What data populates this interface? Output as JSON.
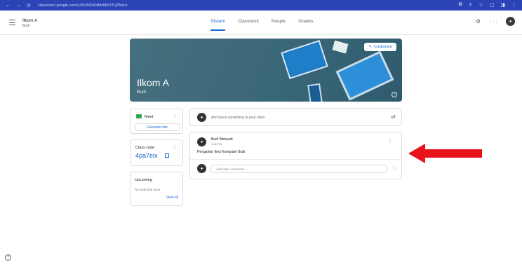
{
  "browser": {
    "nav_icons": [
      "←",
      "→",
      "⟳"
    ],
    "url": "classroom.google.com/u/0/c/NDM4MzM0OTQ0Nzcz",
    "right_icons": [
      "⧉",
      "⇪",
      "☆",
      "▢",
      "◨",
      "⋮"
    ]
  },
  "header": {
    "class_name": "Ilkom A",
    "class_section": "Budi",
    "tabs": [
      "Stream",
      "Classwork",
      "People",
      "Grades"
    ],
    "active_tab": "Stream",
    "settings_glyph": "⚙",
    "apps_glyph": "⋮⋮⋮",
    "avatar_glyph": "●"
  },
  "banner": {
    "title": "Ilkom A",
    "subtitle": "Budi",
    "customize_label": "Customize",
    "customize_glyph": "✎",
    "info_glyph": "i"
  },
  "meet": {
    "label": "Meet",
    "generate_link": "Generate link",
    "menu_glyph": "⋮"
  },
  "class_code": {
    "label": "Class code",
    "value": "4pa7eix",
    "menu_glyph": "⋮"
  },
  "upcoming": {
    "title": "Upcoming",
    "empty_text": "No work due soon",
    "view_all": "View all"
  },
  "announce": {
    "placeholder": "Announce something to your class",
    "repost_glyph": "⇄"
  },
  "post": {
    "author": "Budi Wahyudi",
    "time": "3:16 PM",
    "body": "Pengantar Ilmu Komputer Budi",
    "comment_placeholder": "Add class comment...",
    "send_glyph": "▷",
    "menu_glyph": "⋮"
  },
  "help_glyph": "?",
  "colors": {
    "accent": "#1967d2",
    "browser_bar": "#2b44b5",
    "banner": "#3a6778",
    "arrow": "#e8131a"
  }
}
